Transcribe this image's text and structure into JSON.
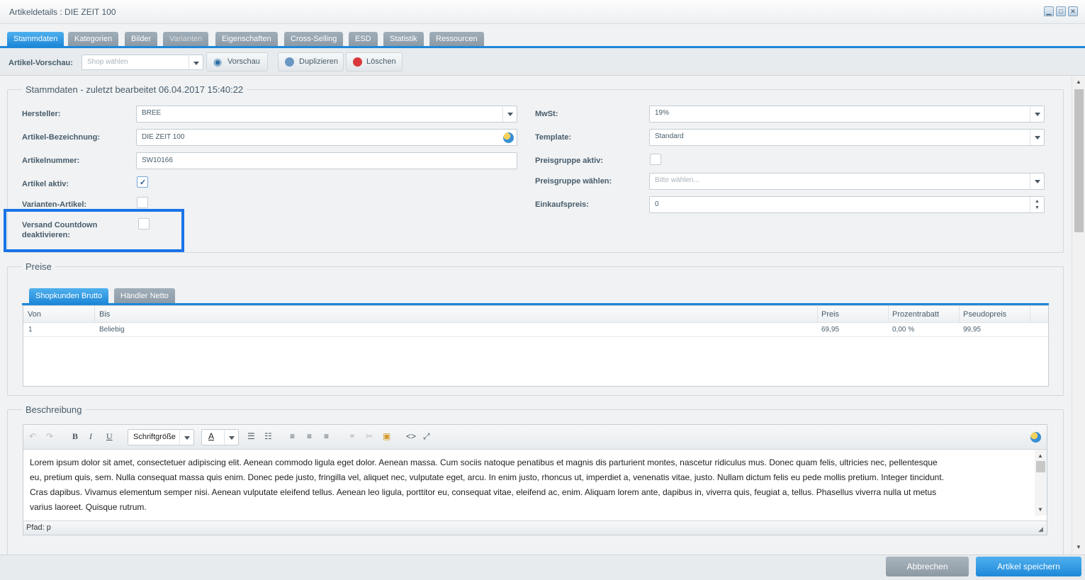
{
  "window": {
    "title": "Artikeldetails : DIE ZEIT 100"
  },
  "tabs": [
    {
      "label": "Stammdaten",
      "state": "active"
    },
    {
      "label": "Kategorien",
      "state": "normal"
    },
    {
      "label": "Bilder",
      "state": "normal"
    },
    {
      "label": "Varianten",
      "state": "disabled"
    },
    {
      "label": "Eigenschaften",
      "state": "normal"
    },
    {
      "label": "Cross-Selling",
      "state": "normal"
    },
    {
      "label": "ESD",
      "state": "normal"
    },
    {
      "label": "Statistik",
      "state": "normal"
    },
    {
      "label": "Ressourcen",
      "state": "normal"
    }
  ],
  "toolbar": {
    "preview_label": "Artikel-Vorschau:",
    "shop_placeholder": "Shop wählen",
    "preview_button": "Vorschau",
    "duplicate_button": "Duplizieren",
    "delete_button": "Löschen"
  },
  "stammdaten": {
    "legend": "Stammdaten - zuletzt bearbeitet 06.04.2017 15:40:22",
    "hersteller_label": "Hersteller:",
    "hersteller_value": "BREE",
    "bezeichnung_label": "Artikel-Bezeichnung:",
    "bezeichnung_value": "DIE ZEIT 100",
    "nummer_label": "Artikelnummer:",
    "nummer_value": "SW10166",
    "aktiv_label": "Artikel aktiv:",
    "aktiv_checked": true,
    "varianten_label": "Varianten-Artikel:",
    "versand_label_line1": "Versand Countdown",
    "versand_label_line2": "deaktivieren:",
    "mwst_label": "MwSt:",
    "mwst_value": "19%",
    "template_label": "Template:",
    "template_value": "Standard",
    "preisgruppe_aktiv_label": "Preisgruppe aktiv:",
    "preisgruppe_waehlen_label": "Preisgruppe wählen:",
    "preisgruppe_placeholder": "Bitte wählen...",
    "einkaufspreis_label": "Einkaufspreis:",
    "einkaufspreis_value": "0"
  },
  "preise": {
    "legend": "Preise",
    "tabs": [
      "Shopkunden Brutto",
      "Händler Netto"
    ],
    "columns": [
      "Von",
      "Bis",
      "Preis",
      "Prozentrabatt",
      "Pseudopreis"
    ],
    "rows": [
      [
        "1",
        "Beliebig",
        "69,95",
        "0,00 %",
        "99,95"
      ]
    ]
  },
  "beschreibung": {
    "legend": "Beschreibung",
    "font_size_select": "Schriftgröße",
    "text_lines": [
      "Lorem ipsum dolor sit amet, consectetuer adipiscing elit. Aenean commodo ligula eget dolor. Aenean massa. Cum sociis natoque penatibus et magnis dis parturient montes, nascetur ridiculus mus. Donec quam felis, ultricies nec, pellentesque",
      "eu, pretium quis, sem. Nulla consequat massa quis enim. Donec pede justo, fringilla vel, aliquet nec, vulputate eget, arcu. In enim justo, rhoncus ut, imperdiet a, venenatis vitae, justo. Nullam dictum felis eu pede mollis pretium. Integer tincidunt.",
      "Cras dapibus. Vivamus elementum semper nisi. Aenean vulputate eleifend tellus. Aenean leo ligula, porttitor eu, consequat vitae, eleifend ac, enim. Aliquam lorem ante, dapibus in, viverra quis, feugiat a, tellus. Phasellus viverra nulla ut metus",
      "varius laoreet. Quisque rutrum."
    ],
    "path_label": "Pfad: p"
  },
  "footer": {
    "cancel_button": "Abbrechen",
    "save_button": "Artikel speichern"
  },
  "colors": {
    "accent": "#1e88d8",
    "highlight": "#1a73e8"
  }
}
